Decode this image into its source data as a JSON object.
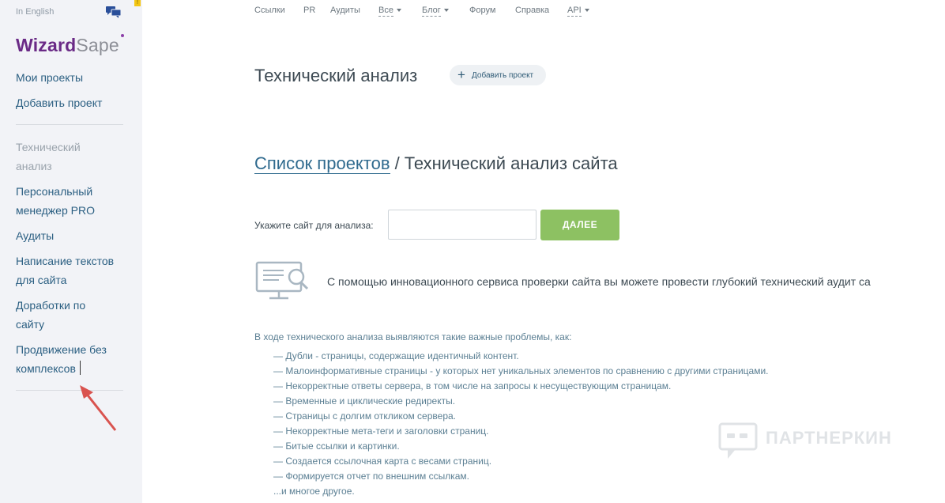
{
  "sidebar": {
    "lang": "In English",
    "logo": {
      "part1": "Wizard",
      "part2": "Sape"
    },
    "notice_badge": "!",
    "top_links": [
      "Мои проекты",
      "Добавить проект"
    ],
    "items": [
      {
        "line1": "Технический",
        "line2": "анализ",
        "active": true
      },
      {
        "line1": "Персональный",
        "line2": "менеджер PRO"
      },
      {
        "line1": "Аудиты",
        "line2": ""
      },
      {
        "line1": "Написание текстов",
        "line2": "для сайта"
      },
      {
        "line1": "Доработки по",
        "line2": "сайту"
      },
      {
        "line1": "Продвижение без",
        "line2": "комплексов"
      }
    ]
  },
  "topmenu": [
    "Ссылки",
    "PR",
    "Аудиты",
    "Все",
    "Блог",
    "Форум",
    "Справка",
    "API"
  ],
  "header": {
    "title": "Технический анализ",
    "add_button": "Добавить проект"
  },
  "breadcrumb": {
    "link": "Список проектов",
    "separator": "/",
    "current": "Технический анализ сайта"
  },
  "form": {
    "label": "Укажите сайт для анализа:",
    "input_value": "",
    "button": "ДАЛЕЕ"
  },
  "intro": "С помощью инновационного сервиса проверки сайта вы можете провести глубокий технический аудит са",
  "issues": {
    "title": "В ходе технического анализа выявляются такие важные проблемы, как:",
    "items": [
      "— Дубли - страницы, содержащие идентичный контент.",
      "— Малоинформативные страницы - у которых нет уникальных элементов по сравнению с другими страницами.",
      "— Некорректные ответы сервера, в том числе на запросы к несуществующим страницам.",
      "— Временные и циклические редиректы.",
      "— Страницы с долгим откликом сервера.",
      "— Некорректные мета-теги и заголовки страниц.",
      "— Битые ссылки и картинки.",
      "— Создается ссылочная карта с весами страниц.",
      "— Формируется отчет по внешним ссылкам.",
      "...и многое другое."
    ]
  },
  "watermark": "ПАРТНЕРКИН",
  "colors": {
    "accent_green": "#8dc162",
    "link_blue": "#2f6a8e",
    "brand_purple": "#6a2a86"
  }
}
